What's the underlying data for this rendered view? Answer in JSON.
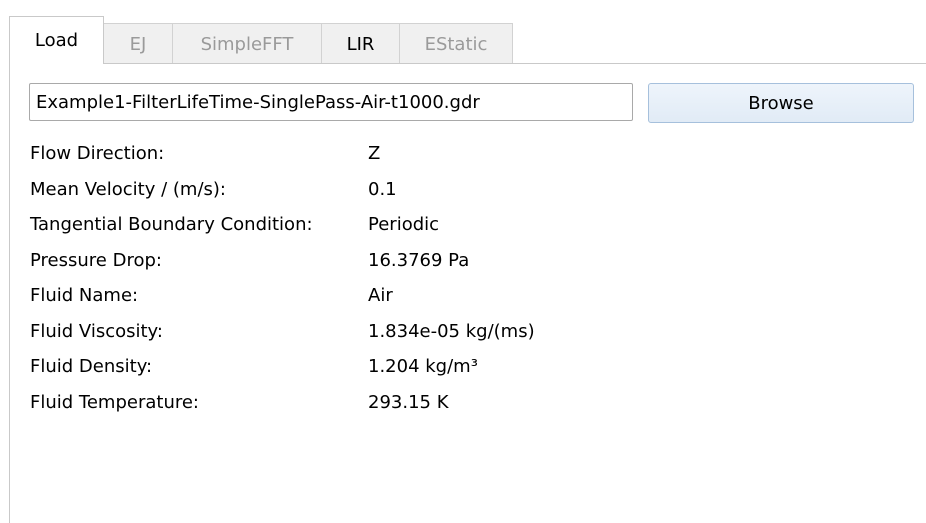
{
  "tabs": [
    {
      "label": "Load",
      "active": true
    },
    {
      "label": "EJ",
      "active": false
    },
    {
      "label": "SimpleFFT",
      "active": false
    },
    {
      "label": "LIR",
      "active": false
    },
    {
      "label": "EStatic",
      "active": false
    }
  ],
  "load": {
    "file_value": "Example1-FilterLifeTime-SinglePass-Air-t1000.gdr",
    "browse_label": "Browse",
    "properties": [
      {
        "label": "Flow Direction:",
        "value": "Z"
      },
      {
        "label": "Mean Velocity / (m/s):",
        "value": "0.1"
      },
      {
        "label": "Tangential Boundary Condition:",
        "value": "Periodic"
      },
      {
        "label": "Pressure Drop:",
        "value": "16.3769 Pa"
      },
      {
        "label": "Fluid Name:",
        "value": "Air"
      },
      {
        "label": "Fluid Viscosity:",
        "value": "1.834e-05 kg/(ms)"
      },
      {
        "label": "Fluid Density:",
        "value": "1.204 kg/m³"
      },
      {
        "label": "Fluid Temperature:",
        "value": "293.15 K"
      }
    ]
  }
}
